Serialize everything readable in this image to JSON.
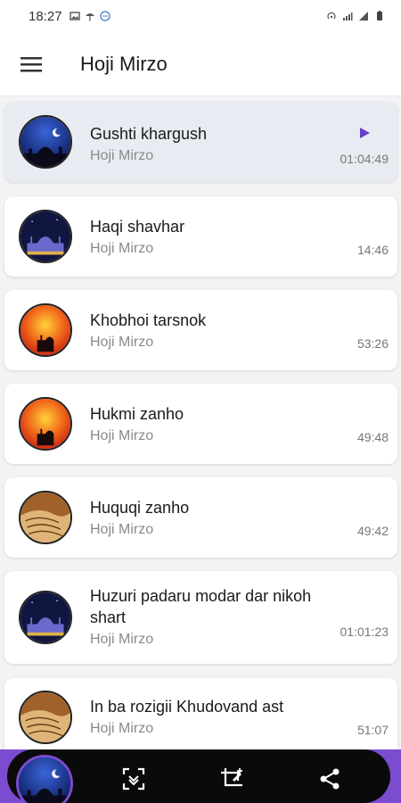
{
  "status_bar": {
    "time": "18:27"
  },
  "app_bar": {
    "title": "Hoji Mirzo"
  },
  "tracks": [
    {
      "title": "Gushti khargush",
      "artist": "Hoji Mirzo",
      "duration": "01:04:49"
    },
    {
      "title": "Haqi shavhar",
      "artist": "Hoji Mirzo",
      "duration": "14:46"
    },
    {
      "title": "Khobhoi tarsnok",
      "artist": "Hoji Mirzo",
      "duration": "53:26"
    },
    {
      "title": "Hukmi zanho",
      "artist": "Hoji Mirzo",
      "duration": "49:48"
    },
    {
      "title": "Huquqi zanho",
      "artist": "Hoji Mirzo",
      "duration": "49:42"
    },
    {
      "title": "Huzuri padaru modar dar nikoh shart",
      "artist": "Hoji Mirzo",
      "duration": "01:01:23"
    },
    {
      "title": "In ba rozigii Khudovand ast",
      "artist": "Hoji Mirzo",
      "duration": "51:07"
    }
  ],
  "colors": {
    "accent": "#7b4bd0",
    "play": "#6a3cc9",
    "active_card": "#e8ebf1"
  },
  "icons": {
    "menu": "menu-icon",
    "play": "play-icon",
    "scan": "scan-icon",
    "crop": "crop-edit-icon",
    "share": "share-icon"
  }
}
